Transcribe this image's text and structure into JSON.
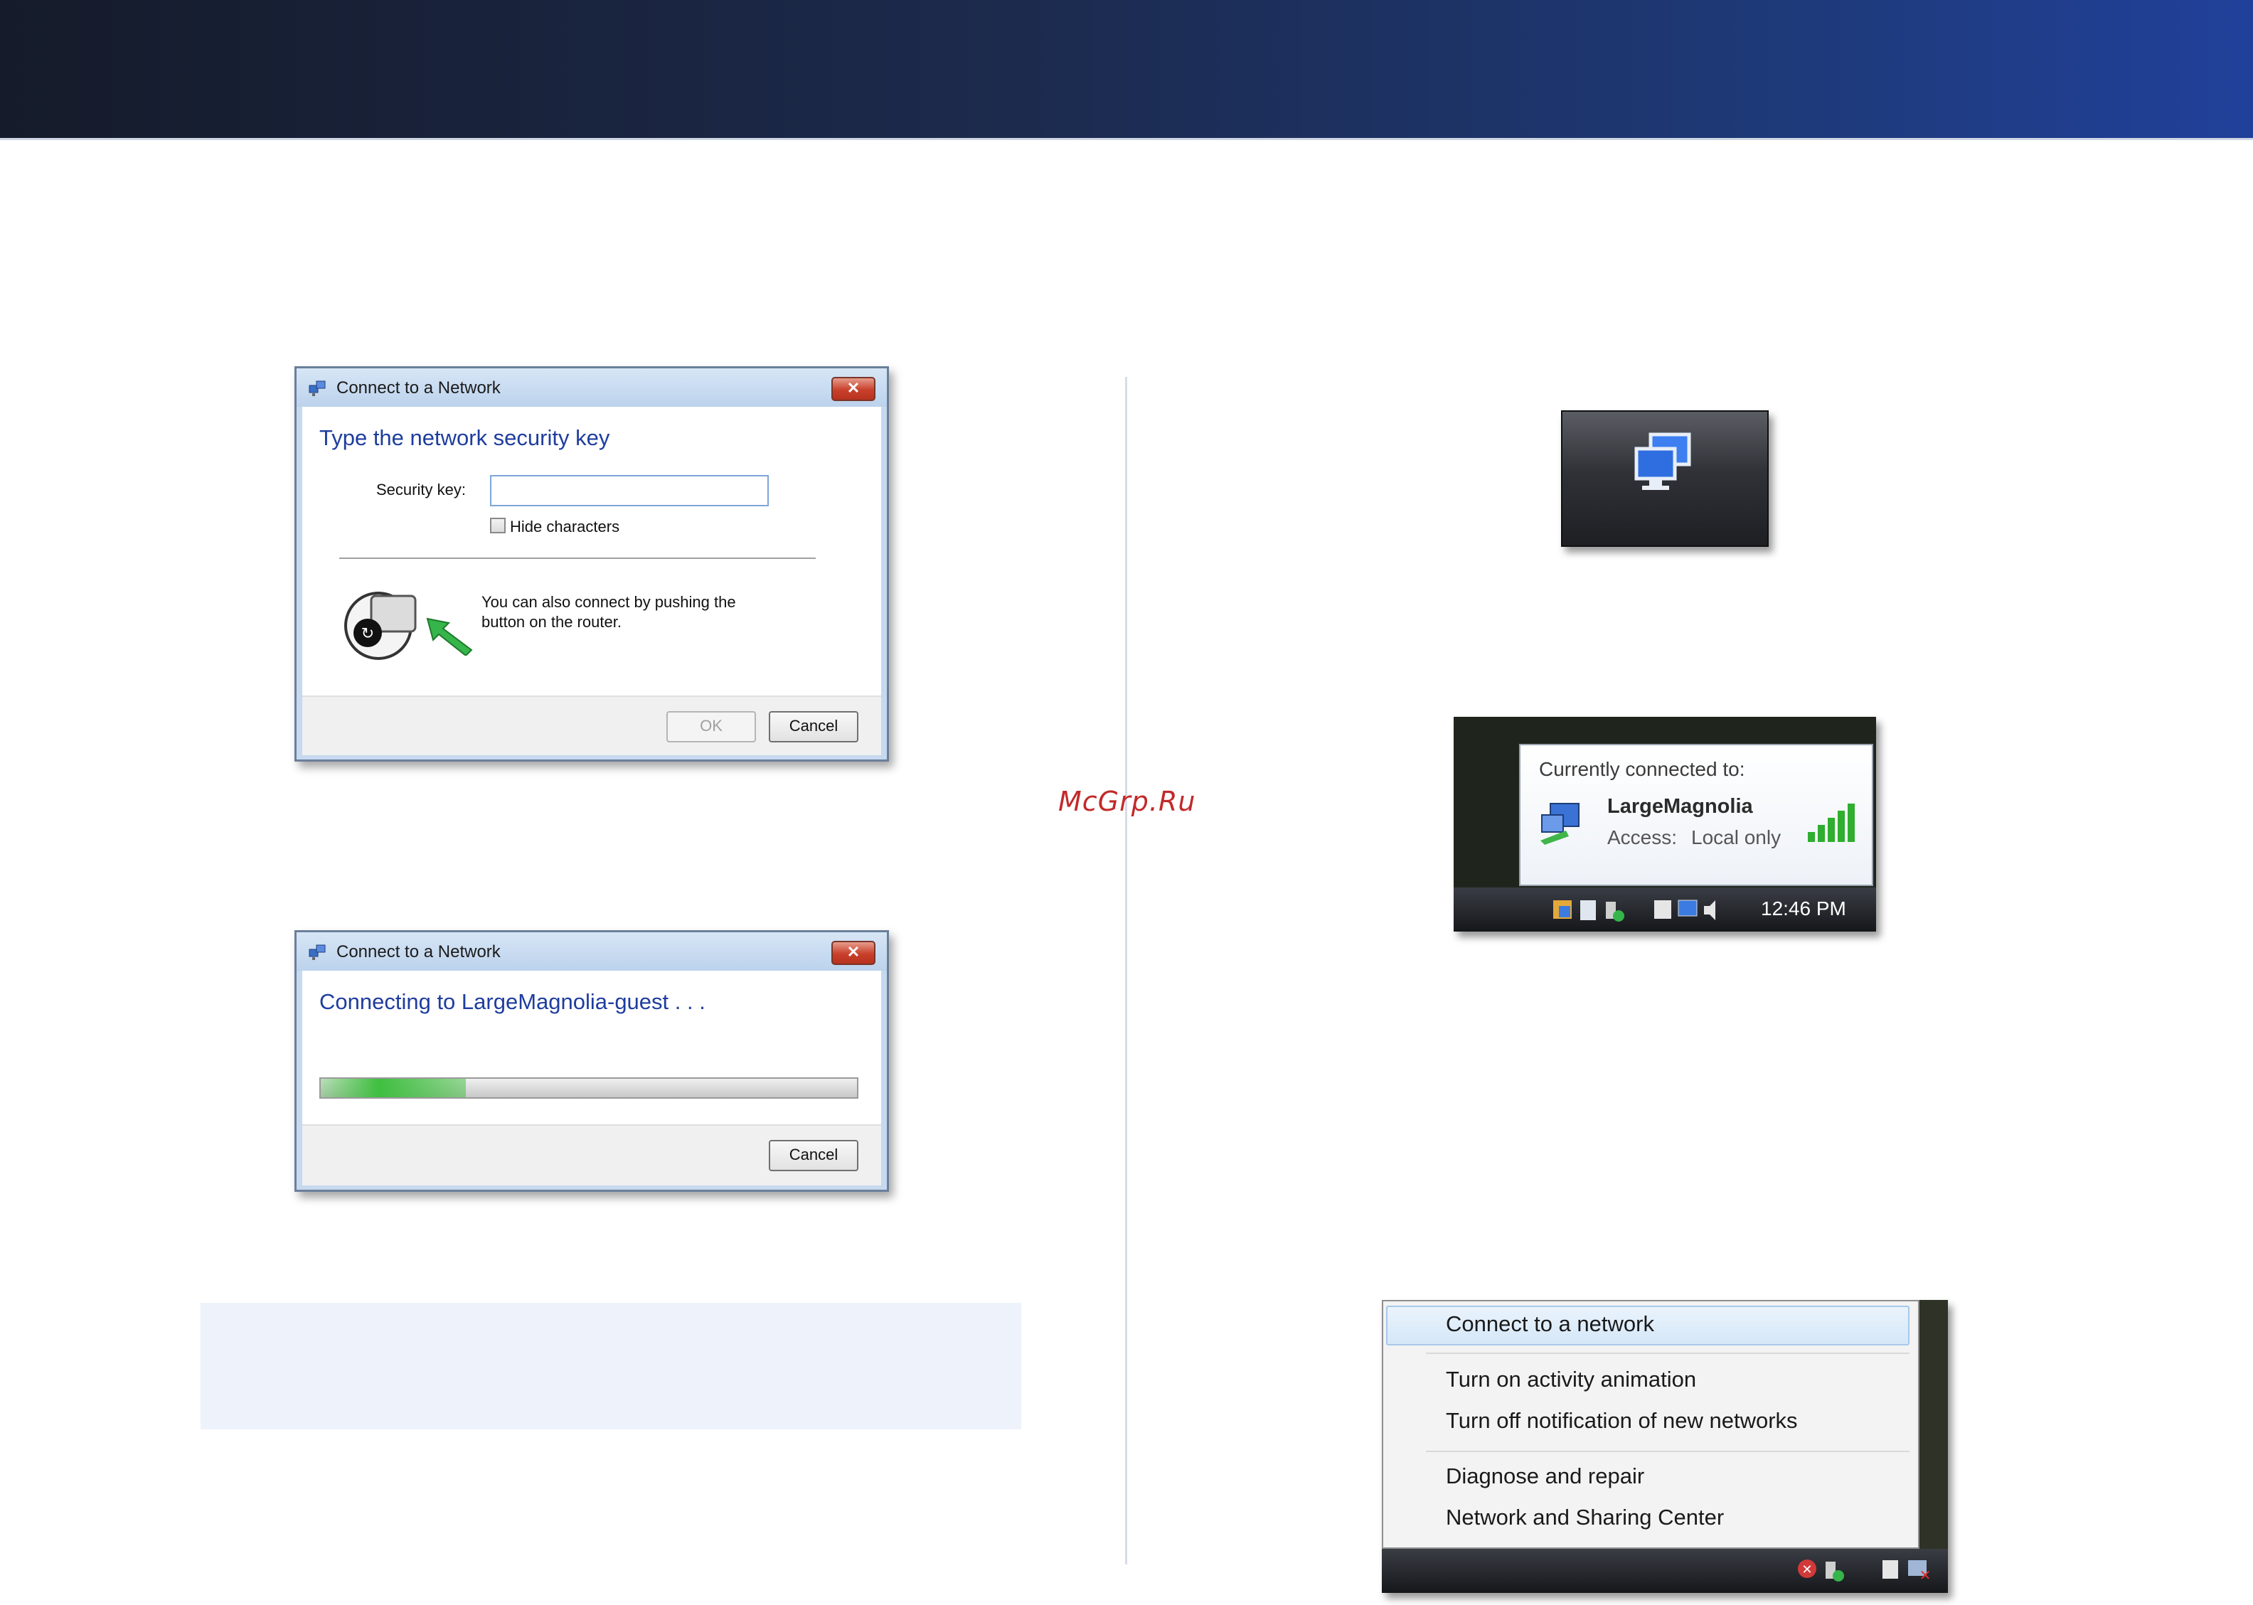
{
  "watermark": "McGrp.Ru",
  "dialog_security_key": {
    "title": "Connect to a Network",
    "close_glyph": "✕",
    "heading": "Type the network security key",
    "security_key_label": "Security key:",
    "security_key_value": "",
    "hide_characters_label": "Hide characters",
    "hide_characters_checked": false,
    "push_button_text_line1": "You can also connect by pushing the",
    "push_button_text_line2": "button on the router.",
    "ok_label": "OK",
    "cancel_label": "Cancel",
    "icons": [
      "network-icon",
      "wps-router-icon",
      "green-arrow-icon"
    ]
  },
  "dialog_connecting": {
    "title": "Connect to a Network",
    "close_glyph": "✕",
    "heading": "Connecting to LargeMagnolia-guest . . .",
    "progress_fraction": 0.27,
    "cancel_label": "Cancel"
  },
  "tray_icon": {
    "icon": "network-computers-icon"
  },
  "connection_status": {
    "title": "Currently connected to:",
    "network_name": "LargeMagnolia",
    "access_label": "Access:",
    "access_value": "Local only",
    "signal_bars": 5,
    "clock": "12:46 PM"
  },
  "context_menu": {
    "items": [
      "Connect to a network",
      "Turn on activity animation",
      "Turn off notification of new networks",
      "Diagnose and repair",
      "Network and Sharing Center"
    ],
    "highlighted_index": 0
  },
  "colors": {
    "banner_dark": "#151b2a",
    "banner_blue": "#21409a",
    "dialog_heading": "#1e3d9e",
    "watermark": "#c22a2a",
    "progress_green": "#3fbf3f",
    "signal_green": "#2fae2f"
  }
}
